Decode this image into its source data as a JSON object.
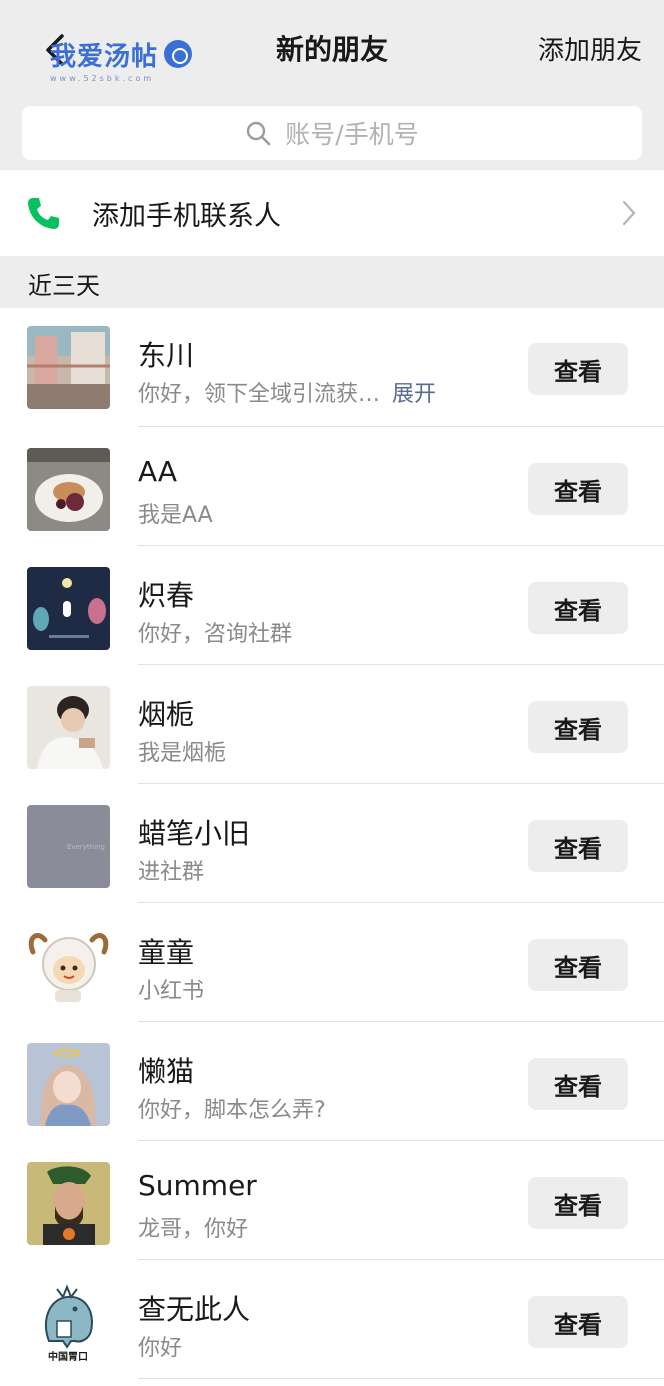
{
  "header": {
    "title": "新的朋友",
    "action_label": "添加朋友",
    "watermark_text": "我爱汤帖",
    "watermark_sub": "www.52sbk.com"
  },
  "search": {
    "placeholder": "账号/手机号"
  },
  "add_contacts": {
    "label": "添加手机联系人"
  },
  "section": {
    "label": "近三天"
  },
  "friends": [
    {
      "name": "东川",
      "message": "你好，领下全域引流获…",
      "expand": "展开",
      "button": "查看"
    },
    {
      "name": "AA",
      "message": "我是AA",
      "button": "查看"
    },
    {
      "name": "炽春",
      "message": "你好，咨询社群",
      "button": "查看"
    },
    {
      "name": "烟栀",
      "message": "我是烟栀",
      "button": "查看"
    },
    {
      "name": "蜡笔小旧",
      "message": "进社群",
      "button": "查看"
    },
    {
      "name": "童童",
      "message": "小红书",
      "button": "查看"
    },
    {
      "name": "懒猫",
      "message": "你好，脚本怎么弄?",
      "button": "查看"
    },
    {
      "name": "Summer",
      "message": "龙哥，你好",
      "button": "查看"
    },
    {
      "name": "查无此人",
      "message": "你好",
      "button": "查看"
    }
  ],
  "avatar_captions": {
    "charcoal": "Everything",
    "dragon": "中国胃口"
  },
  "colors": {
    "background": "#ededed",
    "link": "#576b95",
    "phone_green": "#07c160",
    "button_bg": "#ededed"
  }
}
